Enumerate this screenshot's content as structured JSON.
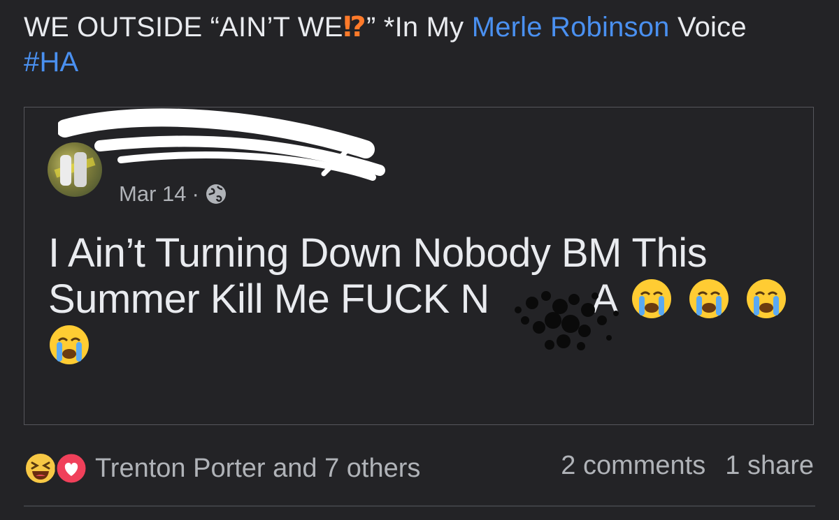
{
  "post": {
    "caption_part1": "WE OUTSIDE “AIN’T WE",
    "caption_mark": "⁉",
    "caption_part2": "” *In My ",
    "caption_link": "Merle Robinson",
    "caption_part3": " Voice",
    "hashtag": "#HA"
  },
  "shared_post": {
    "date": "Mar 14",
    "separator": "·",
    "privacy_icon": "globe-icon",
    "text": "I Ain’t Turning Down Nobody BM This Summer Kill Me FUCK N",
    "text_end": "A",
    "emoji_icon": "loudly-crying-face-icon"
  },
  "footer": {
    "reaction_icons": [
      "haha-icon",
      "love-icon"
    ],
    "reactors": "Trenton Porter and 7 others",
    "comments": "2 comments",
    "shares": "1 share"
  },
  "colors": {
    "background": "#232326",
    "link": "#4a90f0",
    "text": "#e9ebef",
    "muted": "#b0b3b8"
  }
}
